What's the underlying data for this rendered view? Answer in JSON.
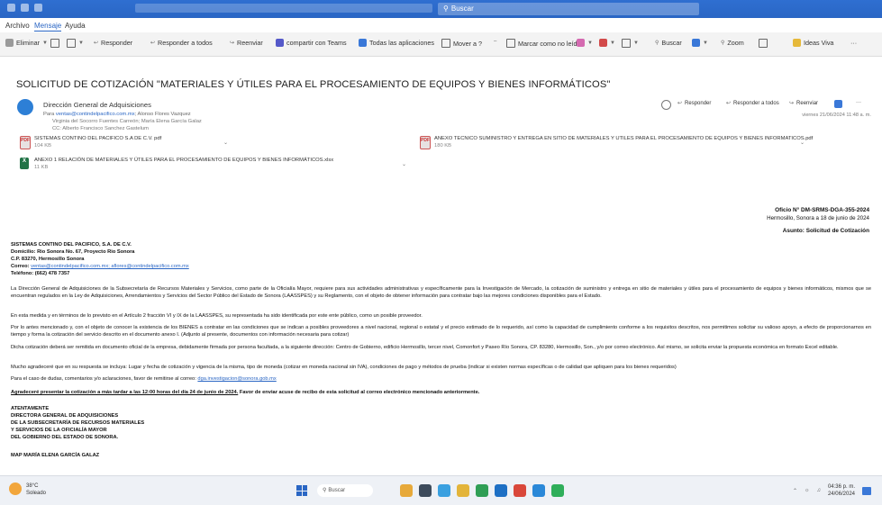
{
  "window": {
    "search_label": "Buscar"
  },
  "menu": [
    "Archivo",
    "Mensaje",
    "Ayuda"
  ],
  "ribbon": {
    "delete": "Eliminar",
    "reply": "Responder",
    "reply_all": "Responder a todos",
    "forward": "Reenviar",
    "teams": "compartir con Teams",
    "apps": "Todas las aplicaciones",
    "move": "Mover a ?",
    "mark_unread": "Marcar como no leído",
    "find": "Buscar",
    "zoom": "Zoom",
    "ideas": "Ideas Viva",
    "more": "···"
  },
  "email": {
    "subject": "SOLICITUD DE COTIZACIÓN \"MATERIALES Y ÚTILES PARA EL PROCESAMIENTO DE EQUIPOS Y BIENES INFORMÁTICOS\"",
    "sender": "Dirección General de Adquisiciones",
    "to_prefix": "Para",
    "to_link": "ventas@contindelpacifico.com.mx",
    "to_rest": "; Alonso Flores Vazquez",
    "cc_line1": "Virginia del Socorro Fuentes Carreón; María Elena García Galaz",
    "cc_line2": "CC: Alberto Francisco Sanchez Gastelum",
    "reply": "Responder",
    "reply_all": "Responder a todos",
    "forward": "Reenviar",
    "more": "···",
    "timestamp": "viernes 21/06/2024 11:48 a. m."
  },
  "attachments": [
    {
      "name": "SISTEMAS CONTINO DEL PACIFICO S.A DE C.V. pdf",
      "size": "104 KB",
      "type": "pdf"
    },
    {
      "name": "ANEXO TECNICO SUMINISTRO Y ENTREGA EN SITIO DE MATERIALES Y UTILES PARA EL PROCESAMIENTO DE EQUIPOS Y BIENES INFORMATICOS.pdf",
      "size": "180 KB",
      "type": "pdf"
    },
    {
      "name": "ANEXO 1 RELACIÓN DE MATERIALES Y ÚTILES PARA EL PROCESAMIENTO DE EQUIPOS Y BIENES INFORMÁTICOS.xlsx",
      "size": "11 KB",
      "type": "xlsx"
    }
  ],
  "letter": {
    "oficio": "Oficio N° DM-SRMS-DGA-355-2024",
    "place_date": "Hermosillo, Sonora a 18 de junio de 2024",
    "asunto": "Asunto: Solicitud de Cotización",
    "recipient": "SISTEMAS CONTINO DEL PACIFICO, S.A. DE C.V.",
    "address1": "Domicilio: Rio Sonora No. 67, Proyecto Rio Sonora",
    "address2": "C.P. 83270, Hermosillo Sonora",
    "email_label": "Correo:",
    "email_value": "ventas@contindelpacifico.com.mx; aflores@contindelpacifico.com.mx",
    "phone": "Teléfono: (662) 478 7357",
    "p1": "La Dirección General de Adquisiciones de la Subsecretaría de Recursos Materiales y Servicios, como parte de la Oficialía Mayor, requiere para sus actividades administrativas y específicamente para la Investigación de Mercado, la cotización de suministro y entrega en sitio de materiales y útiles para el procesamiento de equipos y bienes informáticos, mismos que se encuentran regulados en la Ley de Adquisiciones, Arrendamientos y Servicios del Sector Público del Estado de Sonora (LAASSPES) y su Reglamento, con el objeto de obtener información para contratar bajo las mejores condiciones disponibles para el Estado.",
    "p2": "En esta medida y en términos de lo previsto en el Artículo 2 fracción VI y IX de la LAASSPES, su representada ha sido identificada por este ente público, como un posible proveedor.",
    "p3": "Por lo antes mencionado y, con el objeto de conocer la existencia de los BIENES a contratar en las condiciones que se indican a posibles proveedores a nivel nacional, regional o estatal y el precio estimado de lo requerido, así como la capacidad de cumplimiento conforme a los requisitos descritos, nos permitimos solicitar su valioso apoyo, a efecto de proporcionarnos en tiempo y forma la cotización del servicio descrito en el documento anexo I. (Adjunto al presente, documentos con información necesaria para cotizar)",
    "p4": "Dicha cotización deberá ser remitida en documento oficial de la empresa, debidamente firmada por persona facultada, a la siguiente dirección: Centro de Gobierno, edificio Hermosillo, tercer nivel, Comonfort y Paseo Río Sonora, CP. 83280, Hermosillo, Son., y/o por correo electrónico. Así mismo, se solicita enviar la propuesta económica en formato Excel editable.",
    "p5": "Mucho agradeceré que en su respuesta se incluya: Lugar y fecha de cotización y vigencia de la misma, tipo de moneda (cotizar en moneda nacional sin IVA), condiciones de pago y métodos de prueba (indicar si existen normas específicas o de calidad que apliquen para los bienes requeridos)",
    "p6_pre": "Para el caso de dudas, comentarios y/o aclaraciones, favor de remitirse al correo:",
    "p6_link": "dga.investigacion@sonora.gob.mx",
    "p7_under": "Agradeceré presentar la cotización a más tardar a las 12:00 horas del día 24 de junio de 2024.",
    "p7_rest": "Favor de enviar acuse de recibo de esta solicitud al correo electrónico mencionado anteriormente.",
    "sign1": "ATENTAMENTE",
    "sign2": "DIRECTORA GENERAL DE ADQUISICIONES",
    "sign3": "DE LA SUBSECRETARÍA DE RECURSOS MATERIALES",
    "sign4": "Y SERVICIOS DE LA OFICIALÍA MAYOR",
    "sign5": "DEL GOBIERNO DEL ESTADO DE SONORA.",
    "sign_name": "MAP MARÍA ELENA GARCÍA GALAZ"
  },
  "taskbar": {
    "weather_temp": "38°C",
    "weather_desc": "Soleado",
    "search": "Buscar",
    "time": "04:36 p. m.",
    "date": "24/06/2024"
  }
}
